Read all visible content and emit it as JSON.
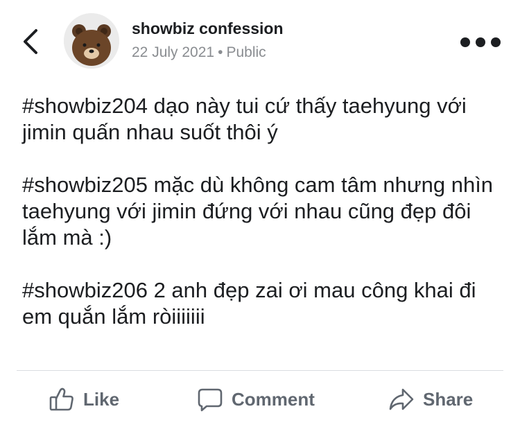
{
  "header": {
    "author": "showbiz confession",
    "date": "22 July 2021",
    "separator": "•",
    "visibility": "Public",
    "back_icon": "chevron-left-icon",
    "more_icon": "more-horizontal-icon",
    "avatar": "brown-bear-avatar"
  },
  "post": {
    "paragraphs": [
      "#showbiz204 dạo này tui cứ thấy taehyung với jimin quấn nhau suốt thôi ý",
      "#showbiz205 mặc dù không cam tâm nhưng nhìn taehyung với jimin đứng với nhau cũng đẹp đôi lắm mà :)",
      "#showbiz206 2 anh đẹp zai ơi mau công khai đi em quắn lắm ròiiiiiii"
    ]
  },
  "actions": {
    "like": {
      "label": "Like",
      "icon": "thumbs-up-icon"
    },
    "comment": {
      "label": "Comment",
      "icon": "comment-icon"
    },
    "share": {
      "label": "Share",
      "icon": "share-arrow-icon"
    }
  },
  "colors": {
    "text": "#1c1e21",
    "meta": "#8a8d91",
    "action": "#606770",
    "divider": "#dadde1"
  }
}
